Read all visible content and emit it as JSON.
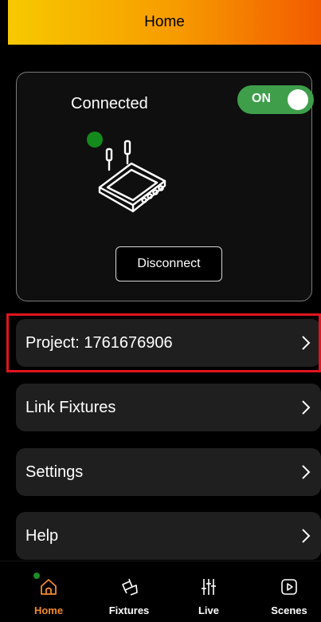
{
  "header": {
    "title": "Home"
  },
  "status": {
    "label": "Connected",
    "toggle_label": "ON",
    "disconnect_label": "Disconnect",
    "indicator_color": "#138a1b"
  },
  "menu": {
    "items": [
      {
        "label": "Project: 1761676906"
      },
      {
        "label": "Link Fixtures"
      },
      {
        "label": "Settings"
      },
      {
        "label": "Help"
      }
    ]
  },
  "nav": {
    "items": [
      {
        "label": "Home",
        "icon": "home-icon",
        "active": true
      },
      {
        "label": "Fixtures",
        "icon": "fixture-icon"
      },
      {
        "label": "Live",
        "icon": "sliders-icon"
      },
      {
        "label": "Scenes",
        "icon": "play-icon"
      }
    ]
  },
  "colors": {
    "accent": "#f28a2b",
    "toggle_on": "#3e9e4a",
    "highlight": "#e0141e"
  }
}
